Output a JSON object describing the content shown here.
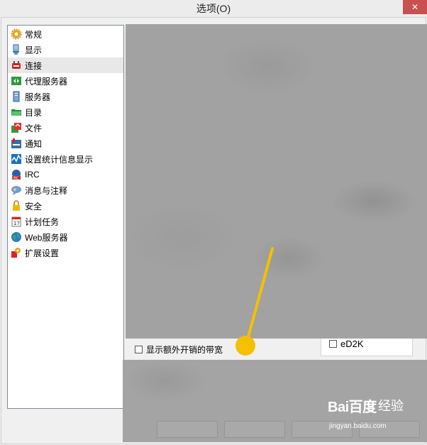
{
  "window": {
    "title": "选项(O)",
    "close_icon": "close-icon"
  },
  "sidebar": {
    "items": [
      {
        "label": "常规",
        "icon": "gear-icon"
      },
      {
        "label": "显示",
        "icon": "monitor-icon"
      },
      {
        "label": "连接",
        "icon": "plug-icon",
        "selected": true
      },
      {
        "label": "代理服务器",
        "icon": "proxy-icon"
      },
      {
        "label": "服务器",
        "icon": "server-icon"
      },
      {
        "label": "目录",
        "icon": "folder-icon"
      },
      {
        "label": "文件",
        "icon": "files-icon"
      },
      {
        "label": "通知",
        "icon": "notification-icon"
      },
      {
        "label": "设置统计信息显示",
        "icon": "statistics-icon"
      },
      {
        "label": "IRC",
        "icon": "irc-icon"
      },
      {
        "label": "消息与注释",
        "icon": "messages-icon"
      },
      {
        "label": "安全",
        "icon": "lock-icon"
      },
      {
        "label": "计划任务",
        "icon": "calendar-icon"
      },
      {
        "label": "Web服务器",
        "icon": "globe-icon"
      },
      {
        "label": "扩展设置",
        "icon": "extension-icon"
      }
    ]
  },
  "connection": {
    "overhead_label": "显示额外开销的带宽",
    "overhead_checked": false,
    "ed2k_label": "eD2K",
    "ed2k_checked": false
  },
  "watermark": {
    "brand": "Bai百度",
    "jingyan": "经验",
    "url": "jingyan.baidu.com"
  },
  "colors": {
    "accent_yellow": "#f5c000",
    "close_red": "#c75050",
    "blur_gray": "#a2a2a2",
    "selected_bg": "#e8e8e8"
  }
}
